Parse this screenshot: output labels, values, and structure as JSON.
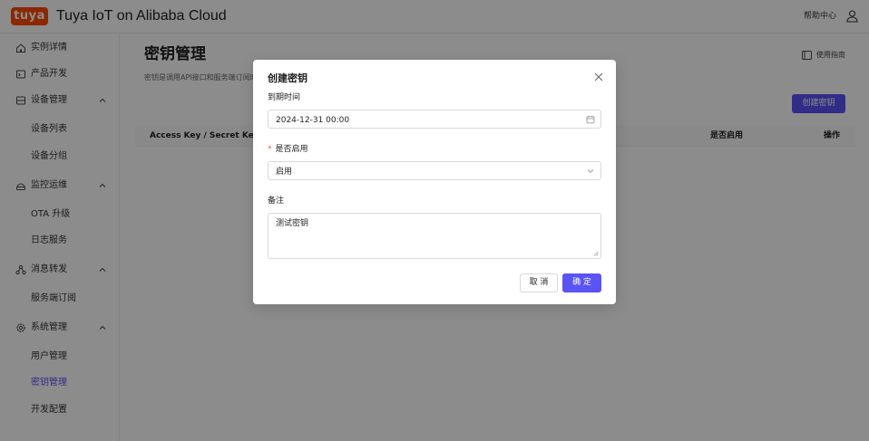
{
  "header": {
    "logo_text": "tuya",
    "app_title": "Tuya IoT on Alibaba Cloud",
    "help_label": "帮助中心",
    "user_icon": "user-icon"
  },
  "sidebar": {
    "items": [
      {
        "label": "实例详情",
        "icon": "home-icon",
        "type": "top"
      },
      {
        "label": "产品开发",
        "icon": "product-icon",
        "type": "top"
      },
      {
        "label": "设备管理",
        "icon": "device-icon",
        "type": "group",
        "expanded": true
      },
      {
        "label": "设备列表",
        "type": "sub"
      },
      {
        "label": "设备分组",
        "type": "sub"
      },
      {
        "label": "监控运维",
        "icon": "monitor-icon",
        "type": "group",
        "expanded": true
      },
      {
        "label": "OTA 升级",
        "type": "sub"
      },
      {
        "label": "日志服务",
        "type": "sub"
      },
      {
        "label": "消息转发",
        "icon": "forward-icon",
        "type": "group",
        "expanded": true
      },
      {
        "label": "服务端订阅",
        "type": "sub"
      },
      {
        "label": "系统管理",
        "icon": "settings-icon",
        "type": "group",
        "expanded": true
      },
      {
        "label": "用户管理",
        "type": "sub"
      },
      {
        "label": "密钥管理",
        "type": "sub",
        "active": true
      },
      {
        "label": "开发配置",
        "type": "sub"
      }
    ]
  },
  "main": {
    "title": "密钥管理",
    "description": "密钥是调用API接口和服务端订阅时",
    "guide_label": "使用指南",
    "create_button": "创建密钥",
    "table_headers": {
      "access_key": "Access Key / Secret Key",
      "enabled": "是否启用",
      "actions": "操作"
    }
  },
  "modal": {
    "title": "创建密钥",
    "expire_label": "到期时间",
    "expire_value": "2024-12-31 00:00",
    "enabled_required_mark": "*",
    "enabled_label": "是否启用",
    "enabled_value": "启用",
    "remark_label": "备注",
    "remark_value": "测试密钥",
    "cancel_label": "取 消",
    "ok_label": "确 定"
  },
  "colors": {
    "brand": "#ff4800",
    "primary": "#5a53f6",
    "required": "#ff4d4f"
  }
}
